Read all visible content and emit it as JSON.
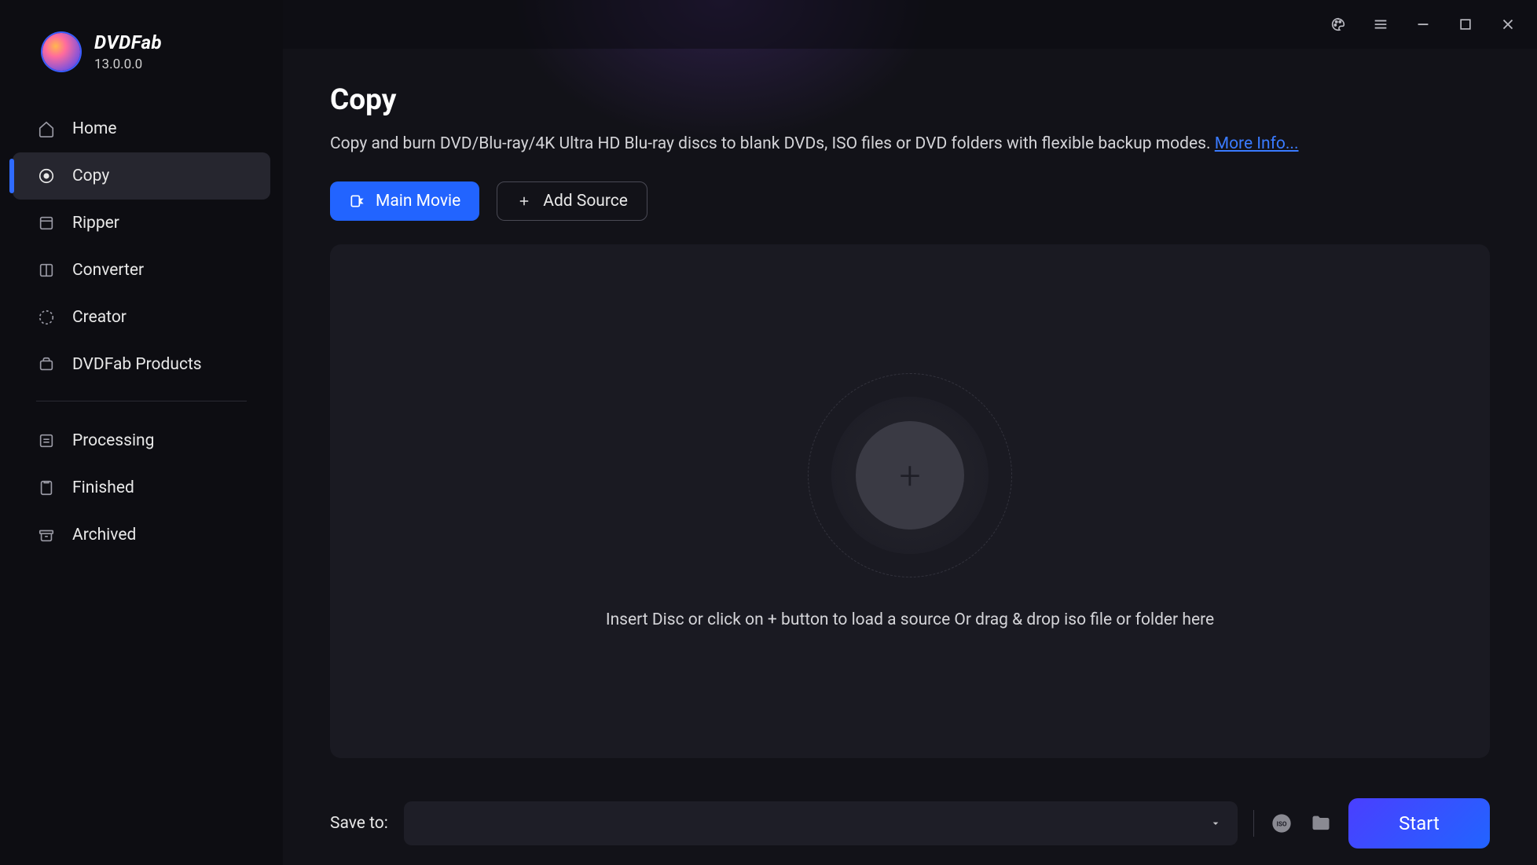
{
  "app": {
    "name": "DVDFab",
    "version": "13.0.0.0"
  },
  "sidebar": {
    "items": [
      {
        "label": "Home"
      },
      {
        "label": "Copy"
      },
      {
        "label": "Ripper"
      },
      {
        "label": "Converter"
      },
      {
        "label": "Creator"
      },
      {
        "label": "DVDFab Products"
      }
    ],
    "tasks": [
      {
        "label": "Processing"
      },
      {
        "label": "Finished"
      },
      {
        "label": "Archived"
      }
    ]
  },
  "page": {
    "title": "Copy",
    "description": "Copy and burn DVD/Blu-ray/4K Ultra HD Blu-ray discs to blank DVDs, ISO files or DVD folders with flexible backup modes. ",
    "more_info": "More Info...",
    "main_movie_btn": "Main Movie",
    "add_source_btn": "Add Source",
    "drop_text": "Insert Disc or click on + button to load a source Or drag & drop iso file or folder here"
  },
  "footer": {
    "save_label": "Save to:",
    "save_path": "",
    "start_btn": "Start"
  }
}
